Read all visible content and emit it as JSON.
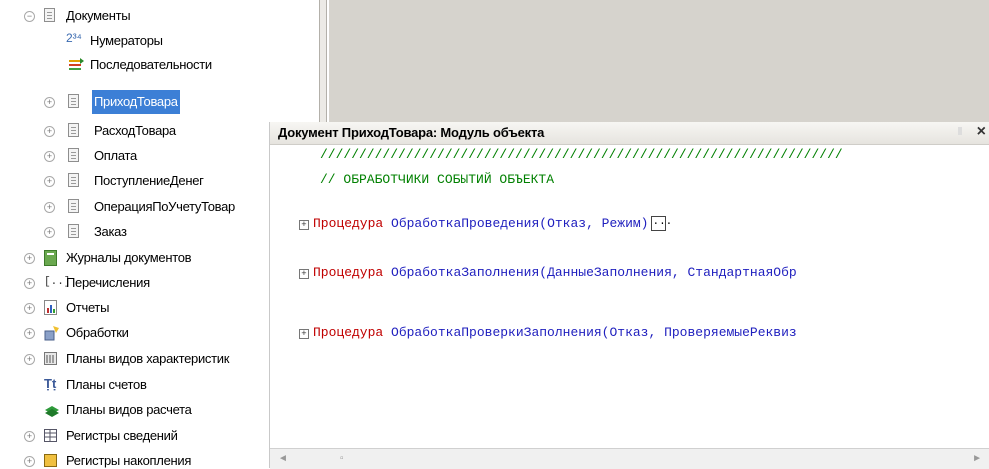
{
  "tree": {
    "items": [
      {
        "label": "Документы",
        "expander": "−",
        "icon": "doc-folder-icon"
      },
      {
        "label": "Нумераторы",
        "expander": "",
        "icon": "numerator-icon"
      },
      {
        "label": "Последовательности",
        "expander": "",
        "icon": "sequence-icon"
      },
      {
        "label": "ПриходТовара",
        "expander": "+",
        "icon": "document-icon",
        "selected": true
      },
      {
        "label": "РасходТовара",
        "expander": "+",
        "icon": "document-icon"
      },
      {
        "label": "Оплата",
        "expander": "+",
        "icon": "document-icon"
      },
      {
        "label": "ПоступлениеДенег",
        "expander": "+",
        "icon": "document-icon"
      },
      {
        "label": "ОперацияПоУчетуТовар",
        "expander": "+",
        "icon": "document-icon"
      },
      {
        "label": "Заказ",
        "expander": "+",
        "icon": "document-icon"
      },
      {
        "label": "Журналы документов",
        "expander": "+",
        "icon": "journal-icon"
      },
      {
        "label": "Перечисления",
        "expander": "+",
        "icon": "enum-icon"
      },
      {
        "label": "Отчеты",
        "expander": "+",
        "icon": "report-icon"
      },
      {
        "label": "Обработки",
        "expander": "+",
        "icon": "processing-icon"
      },
      {
        "label": "Планы видов характеристик",
        "expander": "+",
        "icon": "chart-types-icon"
      },
      {
        "label": "Планы счетов",
        "expander": "",
        "icon": "accounts-icon"
      },
      {
        "label": "Планы видов расчета",
        "expander": "",
        "icon": "calc-types-icon"
      },
      {
        "label": "Регистры сведений",
        "expander": "+",
        "icon": "info-register-icon"
      },
      {
        "label": "Регистры накопления",
        "expander": "+",
        "icon": "accum-register-icon"
      }
    ]
  },
  "editor": {
    "title": "Документ ПриходТовара: Модуль объекта",
    "close": "×",
    "comment_line": "///////////////////////////////////////////////////////////////////",
    "comment_heading": "// ОБРАБОТЧИКИ СОБЫТИЙ ОБЪЕКТА",
    "procedures": [
      {
        "fold": "+",
        "keyword": "Процедура",
        "name": "ОбработкаПроведения",
        "args": "(Отказ, Режим)",
        "collapsed_marker": "..."
      },
      {
        "fold": "+",
        "keyword": "Процедура",
        "name": "ОбработкаЗаполнения",
        "args": "(ДанныеЗаполнения, СтандартнаяОбр",
        "collapsed_marker": ""
      },
      {
        "fold": "+",
        "keyword": "Процедура",
        "name": "ОбработкаПроверкиЗаполнения",
        "args": "(Отказ, ПроверяемыеРеквиз",
        "collapsed_marker": ""
      }
    ]
  }
}
